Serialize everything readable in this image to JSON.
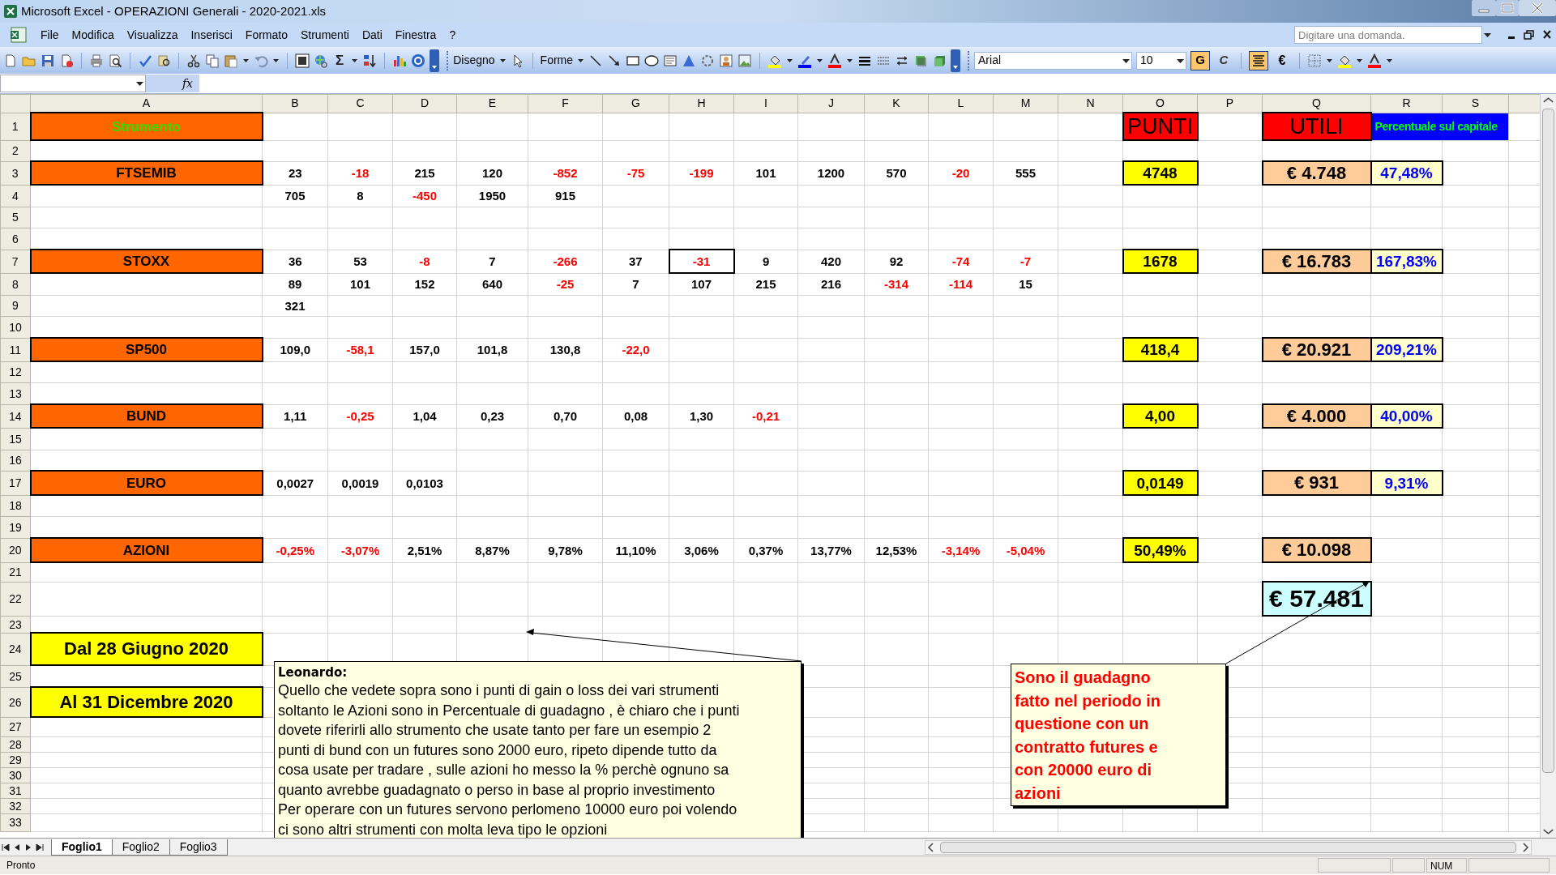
{
  "window": {
    "title": "Microsoft Excel - OPERAZIONI Generali - 2020-2021.xls"
  },
  "menu": [
    {
      "label": "File"
    },
    {
      "label": "Modifica"
    },
    {
      "label": "Visualizza"
    },
    {
      "label": "Inserisci"
    },
    {
      "label": "Formato"
    },
    {
      "label": "Strumenti"
    },
    {
      "label": "Dati"
    },
    {
      "label": "Finestra"
    },
    {
      "label": "?"
    }
  ],
  "help_search": {
    "placeholder": "Digitare una domanda."
  },
  "toolbar": {
    "sum_symbol": "Σ",
    "drawing_menu": "Disegno",
    "shapes_menu": "Forme",
    "font": "Arial",
    "font_size": "10"
  },
  "format_buttons": [
    {
      "kind": "bold",
      "label": "G",
      "selected": true
    },
    {
      "kind": "italic",
      "label": "C",
      "selected": false
    },
    {
      "kind": "center",
      "selected": true
    },
    {
      "kind": "currency",
      "label": "€",
      "selected": false
    }
  ],
  "formula_bar": {
    "function_label": "fx"
  },
  "columns": [
    "A",
    "B",
    "C",
    "D",
    "E",
    "F",
    "G",
    "H",
    "I",
    "J",
    "K",
    "L",
    "M",
    "N",
    "O",
    "P",
    "Q",
    "R",
    "S"
  ],
  "rows": [
    {
      "header": "1",
      "cells": [
        {
          "kind": "header_orange",
          "text": "Strumento"
        },
        null,
        null,
        null,
        null,
        null,
        null,
        null,
        null,
        null,
        null,
        null,
        null,
        null,
        {
          "kind": "header_red",
          "text": "PUNTI"
        },
        null,
        {
          "kind": "header_red",
          "text": "UTILI"
        },
        {
          "kind": "header_blue",
          "text": "Percentuale sul capitale"
        }
      ]
    },
    {
      "header": "2"
    },
    {
      "header": "3",
      "cells": [
        {
          "kind": "label",
          "text": "FTSEMIB"
        },
        {
          "kind": "num",
          "text": "23"
        },
        {
          "kind": "neg",
          "text": "-18"
        },
        {
          "kind": "num",
          "text": "215"
        },
        {
          "kind": "num",
          "text": "120"
        },
        {
          "kind": "neg",
          "text": "-852"
        },
        {
          "kind": "neg",
          "text": "-75"
        },
        {
          "kind": "neg",
          "text": "-199"
        },
        {
          "kind": "num",
          "text": "101"
        },
        {
          "kind": "num",
          "text": "1200"
        },
        {
          "kind": "num",
          "text": "570"
        },
        {
          "kind": "neg",
          "text": "-20"
        },
        {
          "kind": "num",
          "text": "555"
        },
        null,
        {
          "kind": "punti",
          "text": "4748"
        },
        null,
        {
          "kind": "utili",
          "text": "€ 4.748"
        },
        {
          "kind": "pct",
          "text": "47,48%"
        }
      ]
    },
    {
      "header": "4",
      "cells": [
        null,
        {
          "kind": "num",
          "text": "705"
        },
        {
          "kind": "num",
          "text": "8"
        },
        {
          "kind": "neg",
          "text": "-450"
        },
        {
          "kind": "num",
          "text": "1950"
        },
        {
          "kind": "num",
          "text": "915"
        }
      ]
    },
    {
      "header": "5"
    },
    {
      "header": "6"
    },
    {
      "header": "7",
      "cells": [
        {
          "kind": "label",
          "text": "STOXX"
        },
        {
          "kind": "num",
          "text": "36"
        },
        {
          "kind": "num",
          "text": "53"
        },
        {
          "kind": "neg",
          "text": "-8"
        },
        {
          "kind": "num",
          "text": "7"
        },
        {
          "kind": "neg",
          "text": "-266"
        },
        {
          "kind": "num",
          "text": "37"
        },
        {
          "kind": "neg",
          "text": "-31",
          "selected": true
        },
        {
          "kind": "num",
          "text": "9"
        },
        {
          "kind": "num",
          "text": "420"
        },
        {
          "kind": "num",
          "text": "92"
        },
        {
          "kind": "neg",
          "text": "-74"
        },
        {
          "kind": "neg",
          "text": "-7"
        },
        null,
        {
          "kind": "punti",
          "text": "1678"
        },
        null,
        {
          "kind": "utili",
          "text": "€ 16.783"
        },
        {
          "kind": "pct",
          "text": "167,83%"
        }
      ]
    },
    {
      "header": "8",
      "cells": [
        null,
        {
          "kind": "num",
          "text": "89"
        },
        {
          "kind": "num",
          "text": "101"
        },
        {
          "kind": "num",
          "text": "152"
        },
        {
          "kind": "num",
          "text": "640"
        },
        {
          "kind": "neg",
          "text": "-25"
        },
        {
          "kind": "num",
          "text": "7"
        },
        {
          "kind": "num",
          "text": "107"
        },
        {
          "kind": "num",
          "text": "215"
        },
        {
          "kind": "num",
          "text": "216"
        },
        {
          "kind": "neg",
          "text": "-314"
        },
        {
          "kind": "neg",
          "text": "-114"
        },
        {
          "kind": "num",
          "text": "15"
        }
      ]
    },
    {
      "header": "9",
      "cells": [
        null,
        {
          "kind": "num",
          "text": "321"
        }
      ]
    },
    {
      "header": "10"
    },
    {
      "header": "11",
      "cells": [
        {
          "kind": "label",
          "text": "SP500"
        },
        {
          "kind": "num",
          "text": "109,0"
        },
        {
          "kind": "neg",
          "text": "-58,1"
        },
        {
          "kind": "num",
          "text": "157,0"
        },
        {
          "kind": "num",
          "text": "101,8"
        },
        {
          "kind": "num",
          "text": "130,8"
        },
        {
          "kind": "neg",
          "text": "-22,0"
        },
        null,
        null,
        null,
        null,
        null,
        null,
        null,
        {
          "kind": "punti",
          "text": "418,4"
        },
        null,
        {
          "kind": "utili",
          "text": "€ 20.921"
        },
        {
          "kind": "pct",
          "text": "209,21%"
        }
      ]
    },
    {
      "header": "12"
    },
    {
      "header": "13"
    },
    {
      "header": "14",
      "cells": [
        {
          "kind": "label",
          "text": "BUND"
        },
        {
          "kind": "num",
          "text": "1,11"
        },
        {
          "kind": "neg",
          "text": "-0,25"
        },
        {
          "kind": "num",
          "text": "1,04"
        },
        {
          "kind": "num",
          "text": "0,23"
        },
        {
          "kind": "num",
          "text": "0,70"
        },
        {
          "kind": "num",
          "text": "0,08"
        },
        {
          "kind": "num",
          "text": "1,30"
        },
        {
          "kind": "neg",
          "text": "-0,21"
        },
        null,
        null,
        null,
        null,
        null,
        {
          "kind": "punti",
          "text": "4,00"
        },
        null,
        {
          "kind": "utili",
          "text": "€ 4.000"
        },
        {
          "kind": "pct",
          "text": "40,00%"
        }
      ]
    },
    {
      "header": "15"
    },
    {
      "header": "16"
    },
    {
      "header": "17",
      "cells": [
        {
          "kind": "label",
          "text": "EURO"
        },
        {
          "kind": "num",
          "text": "0,0027"
        },
        {
          "kind": "num",
          "text": "0,0019"
        },
        {
          "kind": "num",
          "text": "0,0103"
        },
        null,
        null,
        null,
        null,
        null,
        null,
        null,
        null,
        null,
        null,
        {
          "kind": "punti",
          "text": "0,0149"
        },
        null,
        {
          "kind": "utili",
          "text": "€ 931"
        },
        {
          "kind": "pct",
          "text": "9,31%"
        }
      ]
    },
    {
      "header": "18"
    },
    {
      "header": "19"
    },
    {
      "header": "20",
      "cells": [
        {
          "kind": "label",
          "text": "AZIONI"
        },
        {
          "kind": "neg",
          "text": "-0,25%"
        },
        {
          "kind": "neg",
          "text": "-3,07%"
        },
        {
          "kind": "num",
          "text": "2,51%"
        },
        {
          "kind": "num",
          "text": "8,87%"
        },
        {
          "kind": "num",
          "text": "9,78%"
        },
        {
          "kind": "num",
          "text": "11,10%"
        },
        {
          "kind": "num",
          "text": "3,06%"
        },
        {
          "kind": "num",
          "text": "0,37%"
        },
        {
          "kind": "num",
          "text": "13,77%"
        },
        {
          "kind": "num",
          "text": "12,53%"
        },
        {
          "kind": "neg",
          "text": "-3,14%"
        },
        {
          "kind": "neg",
          "text": "-5,04%"
        },
        null,
        {
          "kind": "punti",
          "text": "50,49%"
        },
        null,
        {
          "kind": "utili",
          "text": "€ 10.098"
        }
      ]
    },
    {
      "header": "21"
    },
    {
      "header": "22",
      "cells": [
        null,
        null,
        null,
        null,
        null,
        null,
        null,
        null,
        null,
        null,
        null,
        null,
        null,
        null,
        null,
        null,
        {
          "kind": "total",
          "text": "€ 57.481"
        }
      ]
    },
    {
      "header": "23"
    },
    {
      "header": "24",
      "cells": [
        {
          "kind": "date",
          "text": "Dal 28 Giugno  2020"
        }
      ]
    },
    {
      "header": "25"
    },
    {
      "header": "26",
      "cells": [
        {
          "kind": "date",
          "text": "Al 31 Dicembre 2020"
        }
      ]
    },
    {
      "header": "27"
    },
    {
      "header": "28"
    },
    {
      "header": "29"
    },
    {
      "header": "30"
    },
    {
      "header": "31"
    },
    {
      "header": "32"
    },
    {
      "header": "33"
    }
  ],
  "comments": [
    {
      "author": "Leonardo:",
      "lines": [
        "Quello che vedete sopra sono i punti di gain o loss dei vari strumenti",
        "soltanto le Azioni sono in Percentuale di guadagno , è chiaro che i punti",
        "dovete riferirli allo strumento che usate tanto per fare un esempio 2",
        "punti di bund con un futures sono 2000 euro, ripeto dipende tutto da",
        "cosa usate per tradare , sulle azioni ho messo la % perchè ognuno sa",
        "quanto avrebbe guadagnato o perso in base al proprio investimento",
        "Per operare con un futures servono perlomeno 10000 euro poi volendo",
        "ci sono altri strumenti con molta leva tipo le opzioni"
      ]
    },
    {
      "lines": [
        "Sono il guadagno",
        "fatto nel periodo in",
        "questione con un",
        "contratto futures e",
        "con 20000 euro di",
        "azioni"
      ]
    }
  ],
  "sheet_tabs": [
    {
      "label": "Foglio1",
      "selected": true
    },
    {
      "label": "Foglio2",
      "selected": false
    },
    {
      "label": "Foglio3",
      "selected": false
    }
  ],
  "status_bar": {
    "status": "Pronto",
    "num_lock": "NUM"
  }
}
